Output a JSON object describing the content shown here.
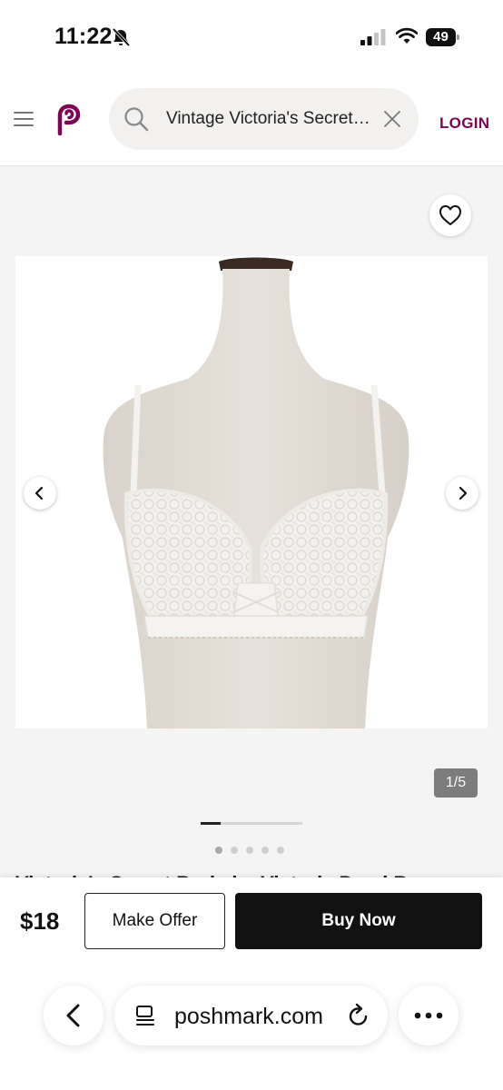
{
  "status_bar": {
    "time": "11:22",
    "battery": "49"
  },
  "header": {
    "search_value": "Vintage Victoria's Secret Body by Victoria Demi Bra",
    "login_label": "LOGIN",
    "brand_color": "#7f0353"
  },
  "gallery": {
    "image_counter": "1/5",
    "current_image": 1,
    "total_images": 5,
    "progress_fraction": 0.2
  },
  "listing": {
    "title": "Victoria's Secret Body by Victoria Demi Bra"
  },
  "purchase": {
    "price": "$18",
    "offer_label": "Make Offer",
    "buy_label": "Buy Now"
  },
  "browser": {
    "url": "poshmark.com"
  },
  "icons": [
    "bell-muted-icon",
    "signal-icon",
    "wifi-icon",
    "battery-icon",
    "menu-icon",
    "poshmark-logo-icon",
    "search-icon",
    "clear-icon",
    "heart-icon",
    "chevron-left-icon",
    "chevron-right-icon",
    "back-icon",
    "reader-icon",
    "reload-icon",
    "more-icon"
  ]
}
